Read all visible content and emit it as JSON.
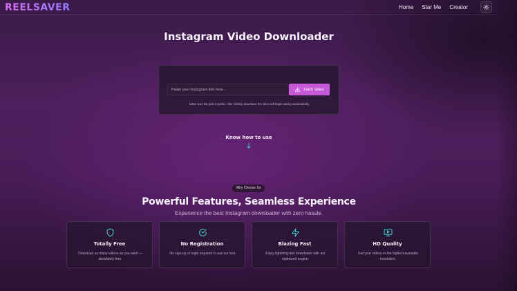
{
  "brand": {
    "logo": "REELSAVER"
  },
  "nav": {
    "items": [
      "Home",
      "Star Me",
      "Creator"
    ]
  },
  "theme_toggle": {
    "icon": "sun-icon"
  },
  "hero": {
    "title": "Instagram Video Downloader"
  },
  "downloader": {
    "placeholder": "Paste your Instagram link here...",
    "value": "",
    "button_label": "Fetch Video",
    "button_icon": "download-icon",
    "note": "Make sure the post is public. After clicking download, the video will begin saving automatically."
  },
  "howto": {
    "label": "Know how to use",
    "icon": "arrow-down-icon"
  },
  "section": {
    "chip": "Why Choose Us",
    "title": "Powerful Features, Seamless Experience",
    "subtitle": "Experience the best Instagram downloader with zero hassle."
  },
  "features": [
    {
      "icon": "shield-icon",
      "title": "Totally Free",
      "desc": "Download as many videos as you want — absolutely free."
    },
    {
      "icon": "check-circle-icon",
      "title": "No Registration",
      "desc": "No sign-up or login required to use our tool."
    },
    {
      "icon": "lightning-icon",
      "title": "Blazing Fast",
      "desc": "Enjoy lightning-fast downloads with our optimized engine."
    },
    {
      "icon": "monitor-play-icon",
      "title": "HD Quality",
      "desc": "Get your videos in the highest available resolution."
    }
  ],
  "colors": {
    "accent": "#c65ad8",
    "icon_teal": "#3ec6c6",
    "logo_from": "#d76cf0",
    "logo_to": "#8f7bff"
  }
}
